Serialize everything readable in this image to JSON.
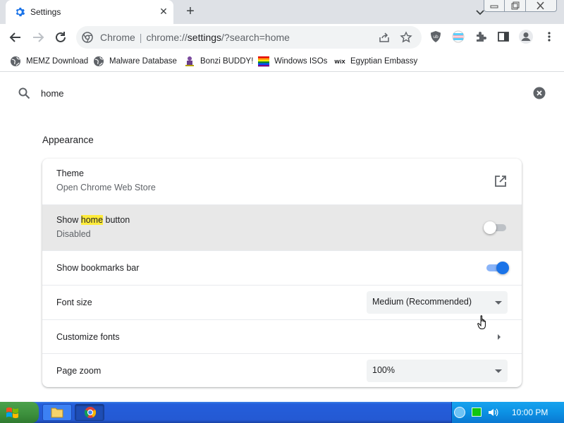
{
  "tab": {
    "title": "Settings",
    "close": "✕",
    "new_tab": "+"
  },
  "omnibox": {
    "site": "Chrome",
    "url_host": "chrome://",
    "url_path": "settings",
    "url_rest": "/?search=home"
  },
  "bookmarks": [
    {
      "label": "MEMZ Download",
      "icon": "globe-icon"
    },
    {
      "label": "Malware Database",
      "icon": "globe-icon"
    },
    {
      "label": "Bonzi BUDDY!",
      "icon": "bonzi-icon"
    },
    {
      "label": "Windows ISOs",
      "icon": "rainbow-flag-icon"
    },
    {
      "label": "Egyptian Embassy",
      "icon": "wix-icon",
      "icon_text": "WiX"
    }
  ],
  "search": {
    "value": "home"
  },
  "section": {
    "title": "Appearance"
  },
  "rows": {
    "theme": {
      "label": "Theme",
      "sub": "Open Chrome Web Store"
    },
    "home_button": {
      "label_pre": "Show ",
      "label_match": "home",
      "label_post": " button",
      "sub": "Disabled",
      "enabled": false
    },
    "bookmarks_bar": {
      "label": "Show bookmarks bar",
      "enabled": true
    },
    "font_size": {
      "label": "Font size",
      "value": "Medium (Recommended)"
    },
    "customize_fonts": {
      "label": "Customize fonts"
    },
    "page_zoom": {
      "label": "Page zoom",
      "value": "100%"
    }
  },
  "taskbar": {
    "clock": "10:00 PM"
  },
  "colors": {
    "accent": "#1a73e8",
    "highlight": "#ffeb3b",
    "taskbar": "#245edb"
  }
}
